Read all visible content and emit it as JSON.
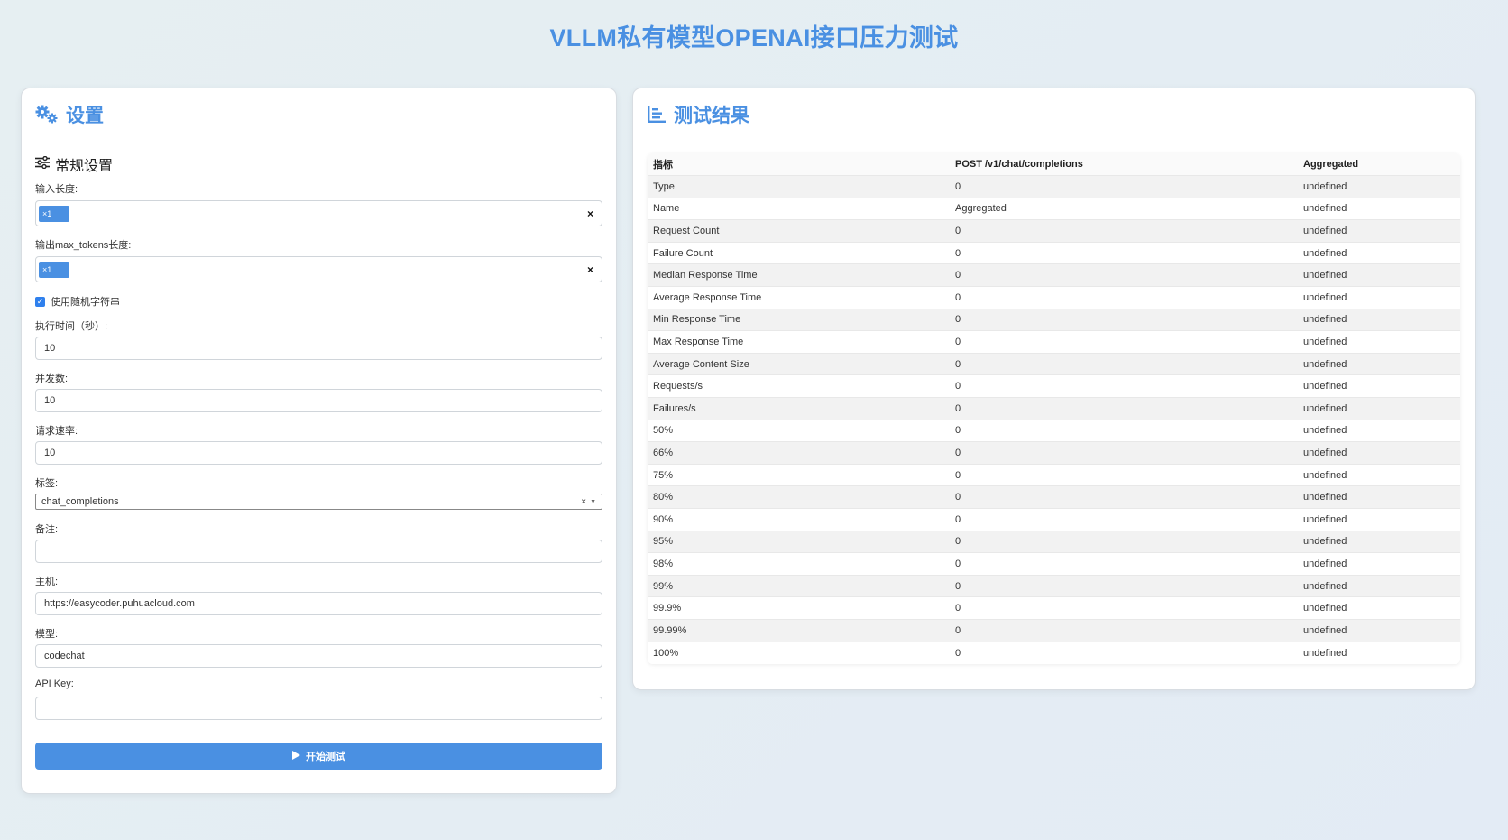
{
  "page": {
    "title": "VLLM私有模型OPENAI接口压力测试"
  },
  "settings": {
    "title": "设置",
    "section_title": "常规设置",
    "input_length_label": "输入长度:",
    "input_length_tag": "×1",
    "output_length_label": "输出max_tokens长度:",
    "output_length_tag": "×1",
    "random_string_label": "使用随机字符串",
    "random_string_checked": true,
    "duration_label": "执行时间（秒）:",
    "duration_value": "10",
    "concurrency_label": "并发数:",
    "concurrency_value": "10",
    "rate_label": "请求速率:",
    "rate_value": "10",
    "tags_label": "标签:",
    "tags_value": "chat_completions",
    "notes_label": "备注:",
    "notes_value": "",
    "host_label": "主机:",
    "host_value": "https://easycoder.puhuacloud.com",
    "model_label": "模型:",
    "model_value": "codechat",
    "apikey_label": "API Key:",
    "apikey_value": "",
    "start_button": "开始测试"
  },
  "results": {
    "title": "测试结果",
    "headers": [
      "指标",
      "POST /v1/chat/completions",
      "Aggregated"
    ],
    "rows": [
      [
        "Type",
        "0",
        "undefined"
      ],
      [
        "Name",
        "Aggregated",
        "undefined"
      ],
      [
        "Request Count",
        "0",
        "undefined"
      ],
      [
        "Failure Count",
        "0",
        "undefined"
      ],
      [
        "Median Response Time",
        "0",
        "undefined"
      ],
      [
        "Average Response Time",
        "0",
        "undefined"
      ],
      [
        "Min Response Time",
        "0",
        "undefined"
      ],
      [
        "Max Response Time",
        "0",
        "undefined"
      ],
      [
        "Average Content Size",
        "0",
        "undefined"
      ],
      [
        "Requests/s",
        "0",
        "undefined"
      ],
      [
        "Failures/s",
        "0",
        "undefined"
      ],
      [
        "50%",
        "0",
        "undefined"
      ],
      [
        "66%",
        "0",
        "undefined"
      ],
      [
        "75%",
        "0",
        "undefined"
      ],
      [
        "80%",
        "0",
        "undefined"
      ],
      [
        "90%",
        "0",
        "undefined"
      ],
      [
        "95%",
        "0",
        "undefined"
      ],
      [
        "98%",
        "0",
        "undefined"
      ],
      [
        "99%",
        "0",
        "undefined"
      ],
      [
        "99.9%",
        "0",
        "undefined"
      ],
      [
        "99.99%",
        "0",
        "undefined"
      ],
      [
        "100%",
        "0",
        "undefined"
      ]
    ]
  },
  "colors": {
    "accent": "#4a90e2",
    "row_alt": "#f2f2f2"
  }
}
